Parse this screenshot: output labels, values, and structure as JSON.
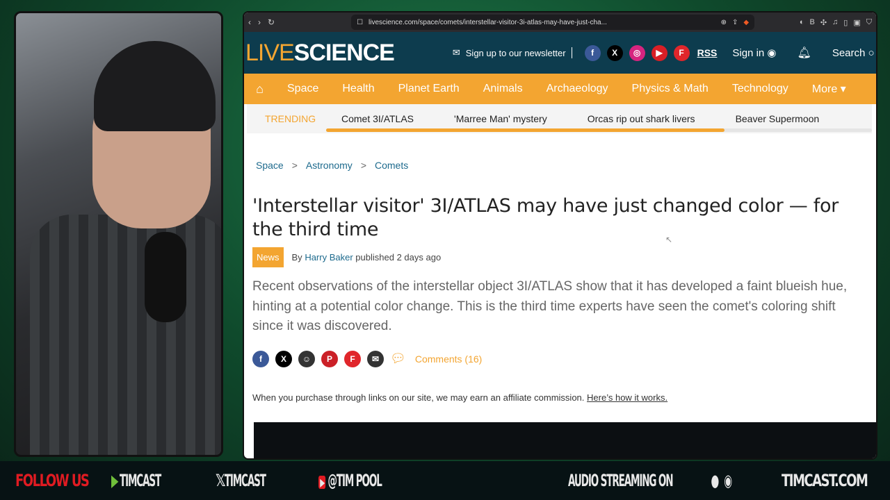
{
  "browser": {
    "url": "livescience.com/space/comets/interstellar-visitor-3i-atlas-may-have-just-cha..."
  },
  "site": {
    "logo_a": "LIVE",
    "logo_b": "SCIENCE",
    "newsletter": "Sign up to our newsletter",
    "rss": "RSS",
    "sign_in": "Sign in",
    "search": "Search"
  },
  "nav": [
    "Space",
    "Health",
    "Planet Earth",
    "Animals",
    "Archaeology",
    "Physics & Math",
    "Technology",
    "More ▾"
  ],
  "trending": {
    "label": "TRENDING",
    "items": [
      "Comet 3I/ATLAS",
      "'Marree Man' mystery",
      "Orcas rip out shark livers",
      "Beaver Supermoon"
    ],
    "scroll_progress_percent": 73
  },
  "breadcrumb": [
    "Space",
    "Astronomy",
    "Comets"
  ],
  "article": {
    "title": "'Interstellar visitor' 3I/ATLAS may have just changed color — for the third time",
    "badge": "News",
    "by": "By",
    "author": "Harry Baker",
    "published": "published 2 days ago",
    "lede": "Recent observations of the interstellar object 3I/ATLAS show that it has developed a faint blueish hue, hinting at a potential color change. This is the third time experts have seen the comet's coloring shift since it was discovered.",
    "comments": "Comments (16)",
    "affiliate": "When you purchase through links on our site, we may earn an affiliate commission.",
    "affiliate_link": "Here’s how it works."
  },
  "footer": {
    "follow": "FOLLOW US",
    "rumble": "TIMCAST",
    "x": "TIMCAST",
    "youtube": "@TIM POOL",
    "audio": "AUDIO STREAMING ON",
    "site": "TIMCAST.COM"
  },
  "colors": {
    "accent": "#f3a531",
    "header": "#0d3c4e"
  }
}
